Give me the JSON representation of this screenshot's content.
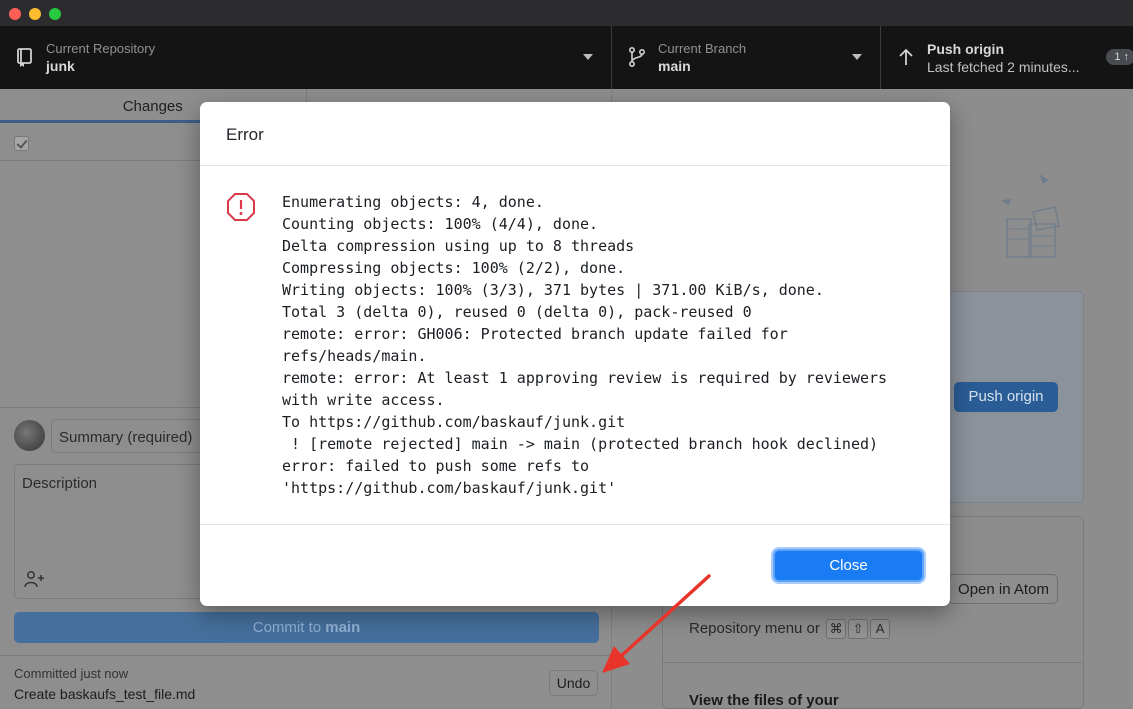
{
  "toolbar": {
    "repo_label": "Current Repository",
    "repo_name": "junk",
    "branch_label": "Current Branch",
    "branch_name": "main",
    "push_title": "Push origin",
    "push_subtitle": "Last fetched 2 minutes...",
    "push_badge": "1 ↑"
  },
  "left_panel": {
    "tabs": [
      {
        "label": "Changes"
      },
      {
        "label": ""
      }
    ],
    "summary_placeholder": "Summary (required)",
    "description_placeholder": "Description",
    "commit_button_prefix": "Commit to ",
    "commit_button_branch": "main",
    "last_commit_time": "Committed just now",
    "last_commit_message": "Create baskaufs_test_file.md",
    "undo_label": "Undo"
  },
  "right_panel": {
    "push_origin_label": "Push origin",
    "open_atom_label": "Open in Atom",
    "repo_menu_text": "Repository menu or",
    "shortcut_keys": [
      "⌘",
      "⇧",
      "A"
    ],
    "view_files_text": "View the files of your"
  },
  "modal": {
    "title": "Error",
    "message": "Enumerating objects: 4, done.\nCounting objects: 100% (4/4), done.\nDelta compression using up to 8 threads\nCompressing objects: 100% (2/2), done.\nWriting objects: 100% (3/3), 371 bytes | 371.00 KiB/s, done.\nTotal 3 (delta 0), reused 0 (delta 0), pack-reused 0\nremote: error: GH006: Protected branch update failed for\nrefs/heads/main.\nremote: error: At least 1 approving review is required by reviewers\nwith write access.\nTo https://github.com/baskauf/junk.git\n ! [remote rejected] main -> main (protected branch hook declined)\nerror: failed to push some refs to\n'https://github.com/baskauf/junk.git'",
    "close_label": "Close"
  },
  "colors": {
    "accent": "#1a7cf5",
    "error_red": "#d73a49",
    "annotation_arrow": "#e8342a"
  },
  "icons": {
    "repo": "repo-icon",
    "branch": "git-branch-icon",
    "push": "arrow-up-icon",
    "error": "stop-icon",
    "coauthor": "person-add-icon"
  }
}
